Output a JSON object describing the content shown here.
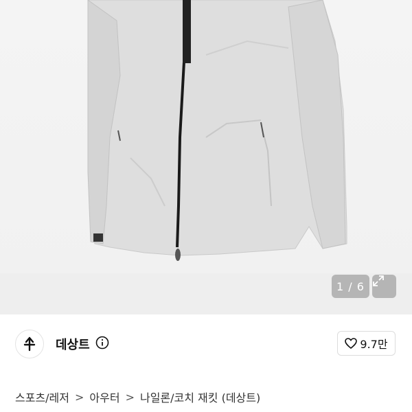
{
  "gallery": {
    "counter": "1 / 6"
  },
  "seller": {
    "name": "데상트",
    "likes": "9.7만"
  },
  "breadcrumb": {
    "items": [
      "스포츠/레저",
      "아우터",
      "나일론/코치 재킷 (데상트)"
    ],
    "separator": ">"
  },
  "icons": {
    "expand": "expand-icon",
    "info": "info-icon",
    "heart": "heart-icon",
    "brand": "descente-logo"
  },
  "colors": {
    "jacket": "#dcdcdc",
    "zipper": "#1a1a1a",
    "overlay": "rgba(110,110,110,0.45)"
  }
}
